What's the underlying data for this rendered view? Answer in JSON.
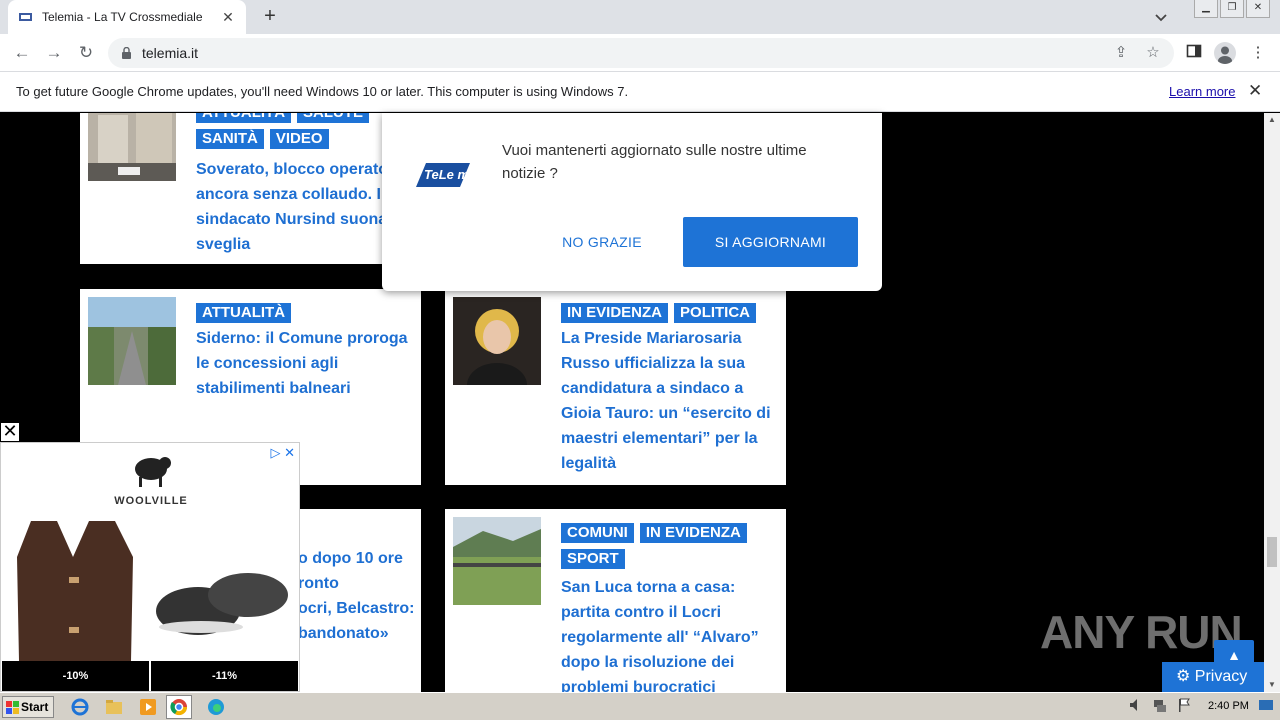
{
  "browser": {
    "tab_title": "Telemia - La TV Crossmediale",
    "new_tab": "+",
    "url": "telemia.it"
  },
  "infobar": {
    "message": "To get future Google Chrome updates, you'll need Windows 10 or later. This computer is using Windows 7.",
    "learn_more": "Learn more"
  },
  "articles": [
    {
      "cats": [
        "ATTUALITÀ",
        "SALUTE",
        "SANITÀ",
        "VIDEO"
      ],
      "title": "Soverato, blocco operatorio ancora senza collaudo. Il sindacato Nursind suona la sveglia"
    },
    {
      "cats": [
        "ATTUALITÀ"
      ],
      "title": "Siderno: il Comune proroga le concessioni agli stabilimenti balneari"
    },
    {
      "cats": [
        "IN EVIDENZA",
        "POLITICA"
      ],
      "title": "La Preside Mariarosaria Russo ufficializza la sua candidatura a sindaco a Gioia Tauro: un “esercito di maestri elementari” per la legalità"
    },
    {
      "cats": [],
      "title": "…o dopo 10 ore …ronto …cri, Belcastro: …bandonato»"
    },
    {
      "cats": [
        "COMUNI",
        "IN EVIDENZA",
        "SPORT"
      ],
      "title": "San Luca torna a casa: partita contro il Locri regolarmente all' “Alvaro” dopo la risoluzione dei problemi burocratici"
    }
  ],
  "partial_titles": [
    "o dopo 10 ore",
    "ronto",
    "ocri, Belcastro:",
    "bandonato»"
  ],
  "popup": {
    "message": "Vuoi mantenerti aggiornato sulle nostre ultime notizie ?",
    "no_label": "NO GRAZIE",
    "yes_label": "SI AGGIORNAMI",
    "logo_text": "TELE mia"
  },
  "ad": {
    "close": "✕",
    "brand": "WOOLVILLE",
    "discount_left": "-10%",
    "discount_right": "-11%"
  },
  "watermark": "ANY RUN",
  "privacy_label": "Privacy",
  "taskbar": {
    "start": "Start",
    "time": "2:40 PM"
  },
  "colors": {
    "accent": "#1e73d6",
    "title": "#1e6fd2"
  }
}
